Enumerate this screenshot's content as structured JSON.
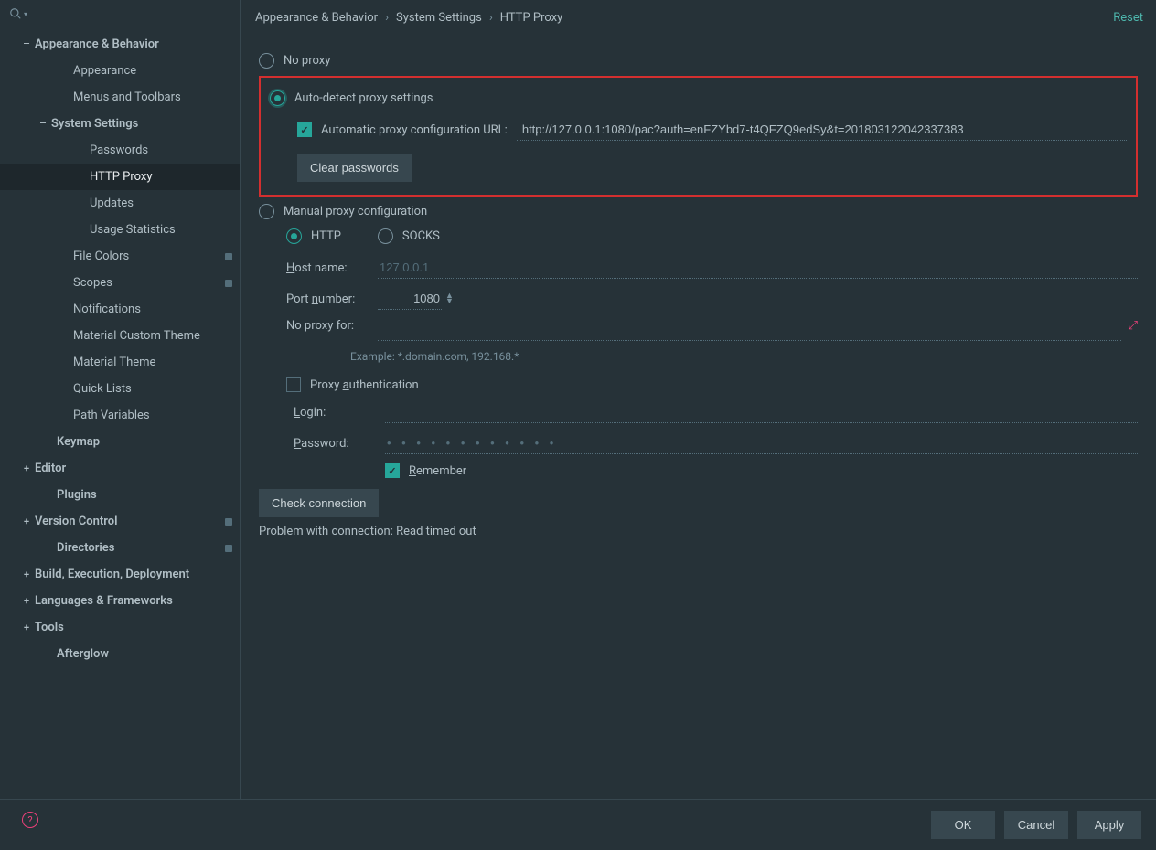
{
  "breadcrumb": {
    "a": "Appearance & Behavior",
    "b": "System Settings",
    "c": "HTTP Proxy"
  },
  "reset": "Reset",
  "sidebar": {
    "items": [
      {
        "label": "Appearance & Behavior",
        "toggle": "minus",
        "pad": 20,
        "bold": true
      },
      {
        "label": "Appearance",
        "toggle": "none",
        "pad": 62
      },
      {
        "label": "Menus and Toolbars",
        "toggle": "none",
        "pad": 62
      },
      {
        "label": "System Settings",
        "toggle": "minus",
        "pad": 38,
        "bold": true
      },
      {
        "label": "Passwords",
        "toggle": "none",
        "pad": 80
      },
      {
        "label": "HTTP Proxy",
        "toggle": "none",
        "pad": 80,
        "selected": true
      },
      {
        "label": "Updates",
        "toggle": "none",
        "pad": 80
      },
      {
        "label": "Usage Statistics",
        "toggle": "none",
        "pad": 80
      },
      {
        "label": "File Colors",
        "toggle": "none",
        "pad": 62,
        "badge": true
      },
      {
        "label": "Scopes",
        "toggle": "none",
        "pad": 62,
        "badge": true
      },
      {
        "label": "Notifications",
        "toggle": "none",
        "pad": 62
      },
      {
        "label": "Material Custom Theme",
        "toggle": "none",
        "pad": 62
      },
      {
        "label": "Material Theme",
        "toggle": "none",
        "pad": 62
      },
      {
        "label": "Quick Lists",
        "toggle": "none",
        "pad": 62
      },
      {
        "label": "Path Variables",
        "toggle": "none",
        "pad": 62
      },
      {
        "label": "Keymap",
        "toggle": "none",
        "pad": 44,
        "bold": true
      },
      {
        "label": "Editor",
        "toggle": "plus",
        "pad": 20,
        "bold": true
      },
      {
        "label": "Plugins",
        "toggle": "none",
        "pad": 44,
        "bold": true
      },
      {
        "label": "Version Control",
        "toggle": "plus",
        "pad": 20,
        "bold": true,
        "badge": true
      },
      {
        "label": "Directories",
        "toggle": "none",
        "pad": 44,
        "bold": true,
        "badge": true
      },
      {
        "label": "Build, Execution, Deployment",
        "toggle": "plus",
        "pad": 20,
        "bold": true
      },
      {
        "label": "Languages & Frameworks",
        "toggle": "plus",
        "pad": 20,
        "bold": true
      },
      {
        "label": "Tools",
        "toggle": "plus",
        "pad": 20,
        "bold": true
      },
      {
        "label": "Afterglow",
        "toggle": "none",
        "pad": 44,
        "bold": true
      }
    ]
  },
  "proxy": {
    "no_proxy": "No proxy",
    "auto_detect": "Auto-detect proxy settings",
    "auto_url_label": "Automatic proxy configuration URL:",
    "auto_url_value": "http://127.0.0.1:1080/pac?auth=enFZYbd7-t4QFZQ9edSy&t=201803122042337383",
    "clear_pw": "Clear passwords",
    "manual": "Manual proxy configuration",
    "proto_http": "HTTP",
    "proto_socks": "SOCKS",
    "host_label": "Host name:",
    "host_placeholder": "127.0.0.1",
    "port_label": "Port number:",
    "port_value": "1080",
    "no_proxy_for_label": "No proxy for:",
    "no_proxy_hint": "Example: *.domain.com, 192.168.*",
    "auth_label": "Proxy authentication",
    "login_label": "Login:",
    "password_label": "Password:",
    "remember": "Remember",
    "check": "Check connection",
    "status": "Problem with connection: Read timed out"
  },
  "footer": {
    "ok": "OK",
    "cancel": "Cancel",
    "apply": "Apply"
  }
}
